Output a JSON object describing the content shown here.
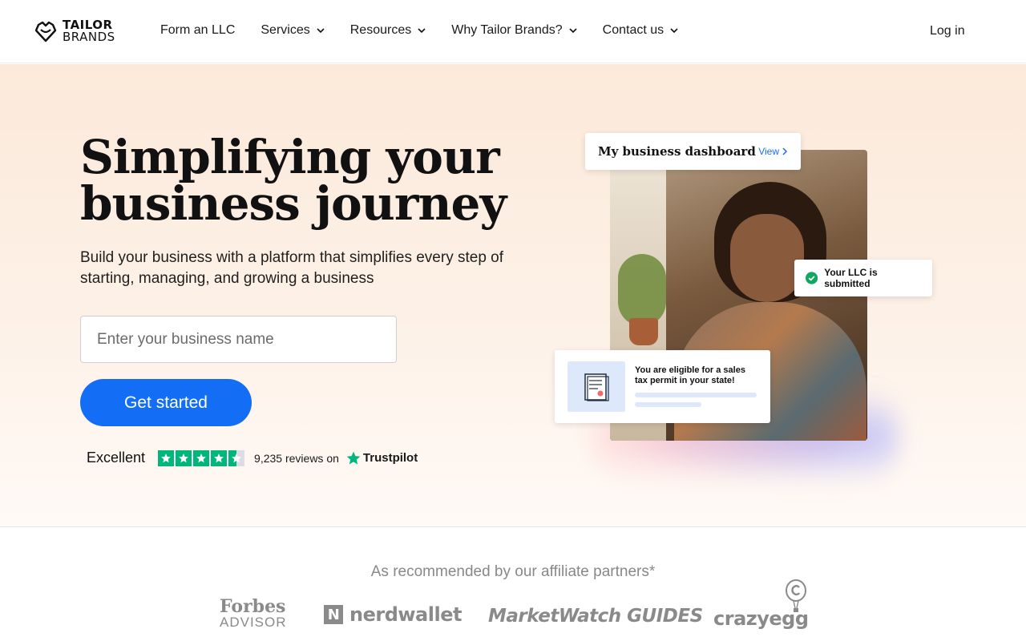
{
  "brand": {
    "line1": "TAILOR",
    "line2": "BRANDS"
  },
  "nav": {
    "items": [
      {
        "label": "Form an LLC",
        "dropdown": false
      },
      {
        "label": "Services",
        "dropdown": true
      },
      {
        "label": "Resources",
        "dropdown": true
      },
      {
        "label": "Why Tailor Brands?",
        "dropdown": true
      },
      {
        "label": "Contact us",
        "dropdown": true
      }
    ],
    "login": "Log in"
  },
  "hero": {
    "title": "Simplifying your business journey",
    "subtitle": "Build your business with a platform that simplifies every step of starting, managing, and growing a business",
    "input_placeholder": "Enter your business name",
    "cta": "Get started",
    "trustpilot": {
      "rating_word": "Excellent",
      "stars": 4.5,
      "reviews": "9,235 reviews on",
      "brand": "Trustpilot"
    }
  },
  "visual": {
    "dashboard_title": "My business dashboard",
    "dashboard_link": "View",
    "llc_status": "Your LLC is submitted",
    "permit_text": "You are eligible for a sales tax permit in your state!"
  },
  "partners": {
    "title": "As recommended by our affiliate partners*",
    "logos": [
      "Forbes",
      "ADVISOR",
      "nerdwallet",
      "MarketWatch GUIDES",
      "crazyegg"
    ]
  },
  "colors": {
    "accent": "#146ef5",
    "trustpilot": "#00b67a",
    "success": "#10a760"
  }
}
